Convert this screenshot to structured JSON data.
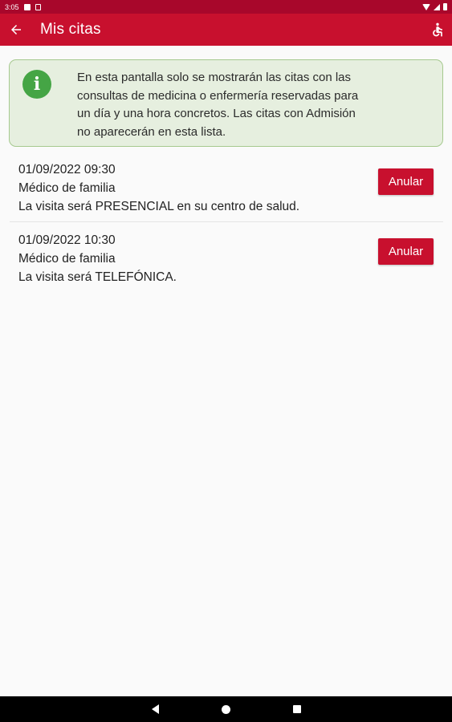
{
  "status_bar": {
    "time": "3:05"
  },
  "app_bar": {
    "title": "Mis citas"
  },
  "info": {
    "lines": [
      "En esta pantalla solo se mostrarán las citas con las",
      "consultas de medicina o enfermería reservadas para",
      "un día y una hora concretos. Las citas con Admisión",
      "no aparecerán en esta lista."
    ]
  },
  "appointments": [
    {
      "datetime": "01/09/2022 09:30",
      "service": "Médico de familia",
      "modality": "La visita será PRESENCIAL en su centro de salud.",
      "cancel_label": "Anular"
    },
    {
      "datetime": "01/09/2022 10:30",
      "service": "Médico de familia",
      "modality": "La visita será TELEFÓNICA.",
      "cancel_label": "Anular"
    }
  ],
  "colors": {
    "primary": "#c8102e",
    "status_bar": "#a8072b",
    "info_bg": "#e6efdf",
    "info_border": "#a6c98f",
    "info_icon": "#45a545"
  },
  "icons": {
    "back": "arrow-left-icon",
    "accessibility": "wheelchair-icon",
    "info": "info-icon"
  }
}
